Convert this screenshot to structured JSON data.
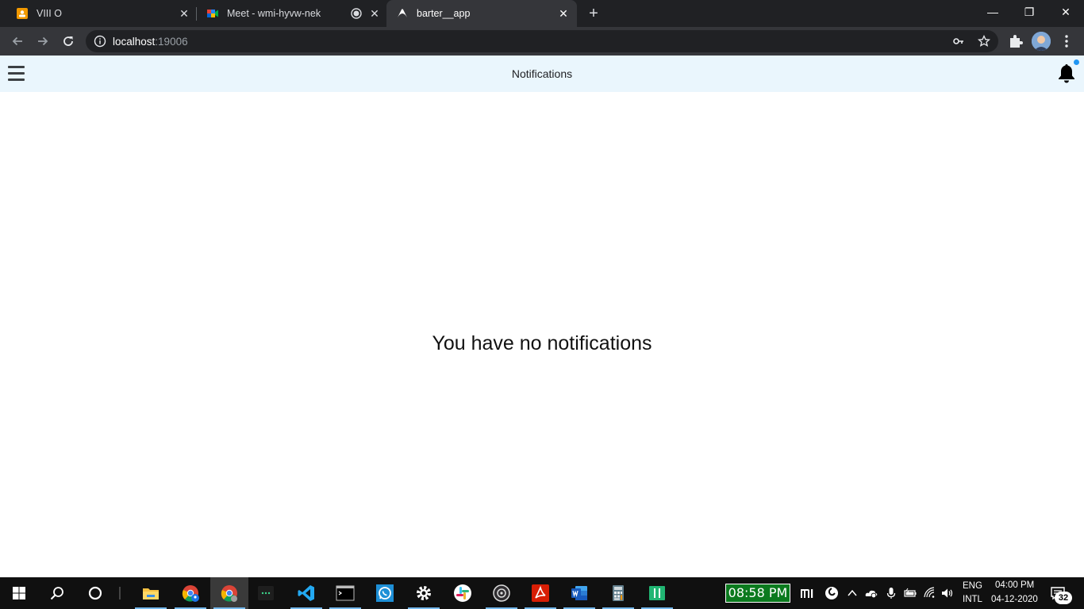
{
  "browser": {
    "tabs": [
      {
        "label": "VIII O",
        "active": false
      },
      {
        "label": "Meet - wmi-hyvw-nek",
        "active": false,
        "recording": true
      },
      {
        "label": "barter__app",
        "active": true
      }
    ],
    "url_host": "localhost",
    "url_port": ":19006"
  },
  "app": {
    "header_title": "Notifications",
    "empty_message": "You have no notifications",
    "accent": "#2196f3",
    "header_bg": "#eaf6fd"
  },
  "taskbar": {
    "clock_widget": "08:58 PM",
    "lang_line1": "ENG",
    "lang_line2": "INTL",
    "time": "04:00 PM",
    "date": "04-12-2020",
    "notification_count": "32",
    "apps": [
      "file-explorer-icon",
      "chrome-profile-icon",
      "chrome-icon",
      "terminal-dots-icon",
      "vscode-icon",
      "command-prompt-icon",
      "whatsapp-icon",
      "settings-icon",
      "slack-icon",
      "obs-icon",
      "acrobat-icon",
      "word-icon",
      "calculator-icon",
      "notepad-icon"
    ]
  }
}
